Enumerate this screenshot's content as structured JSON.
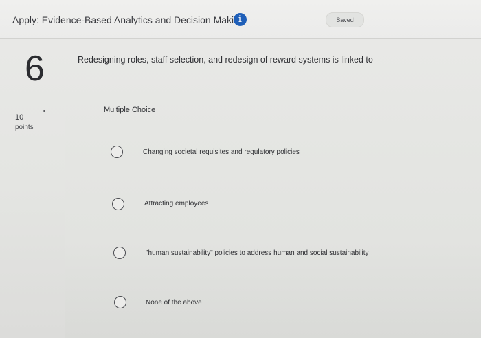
{
  "header": {
    "assignment_title": "Apply: Evidence-Based Analytics and Decision Maki...",
    "info_icon": "info-icon",
    "saved_label": "Saved"
  },
  "question": {
    "number": "6",
    "points_value": "10",
    "points_label": "points",
    "text": "Redesigning roles, staff selection, and redesign of reward systems is linked to",
    "type": "Multiple Choice",
    "options": [
      {
        "label": "Changing societal requisites and regulatory policies"
      },
      {
        "label": "Attracting employees"
      },
      {
        "label": "\"human sustainability\" policies to address human and social sustainability"
      },
      {
        "label": "None of the above"
      }
    ]
  },
  "colors": {
    "info_icon_bg": "#1f5fb8",
    "background": "#e5e6e3"
  }
}
